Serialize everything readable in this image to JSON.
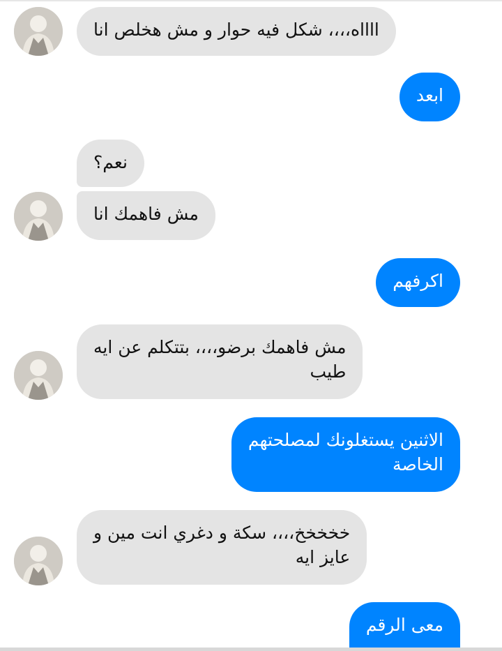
{
  "chat": {
    "messages": [
      {
        "side": "in",
        "text": "ااااه،،،، شكل فيه حوار و مش هخلص انا"
      },
      {
        "side": "out",
        "text": "ابعد"
      },
      {
        "side": "in",
        "text": "نعم؟"
      },
      {
        "side": "in",
        "text": "مش فاهمك انا"
      },
      {
        "side": "out",
        "text": "اكرفهم"
      },
      {
        "side": "in",
        "text": "مش فاهمك برضو،،،، بتتكلم عن ايه\nطيب"
      },
      {
        "side": "out",
        "text": "الاثنين يستغلونك لمصلحتهم\nالخاصة"
      },
      {
        "side": "in",
        "text": "خخخخخ،،،، سكة و دغري انت مين و\nعايز ايه"
      },
      {
        "side": "out",
        "text": "معى الرقم"
      }
    ]
  },
  "colors": {
    "outgoing_bubble": "#0084ff",
    "incoming_bubble": "#e4e4e4"
  },
  "icons": {
    "avatar": "contact-avatar-photo"
  }
}
